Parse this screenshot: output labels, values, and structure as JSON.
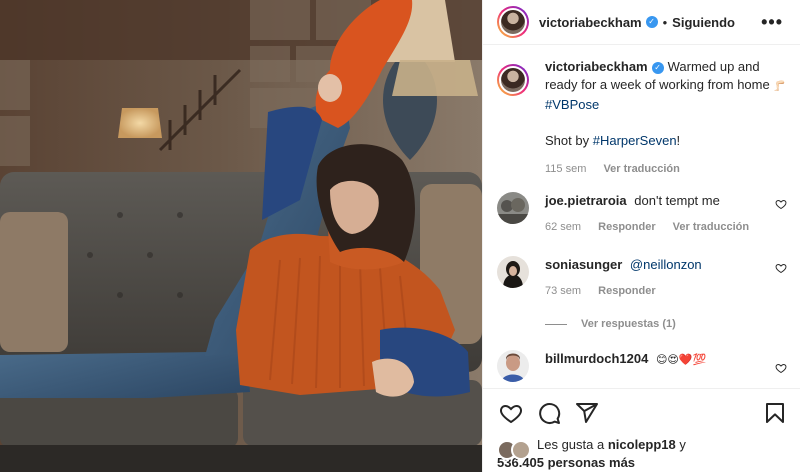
{
  "post": {
    "image_alt": "Photo of a woman in a rust turtleneck stretching one leg up while lying on a grey velvet sofa",
    "icons": {
      "verified": "verified-badge-icon",
      "more": "more-options-icon",
      "like": "heart-icon",
      "comment": "comment-icon",
      "share": "share-icon",
      "save": "bookmark-icon",
      "comment_like": "small-heart-icon"
    },
    "colors": {
      "link": "#00376b",
      "muted": "#8e8e8e",
      "verified": "#3897f0",
      "sweater": "#c2551f"
    }
  },
  "header": {
    "username": "victoriabeckham",
    "verified_glyph": "✓",
    "separator": "•",
    "follow_status": "Siguiendo",
    "more_glyph": "•••"
  },
  "caption": {
    "username": "victoriabeckham",
    "verified_glyph": "✓",
    "text": "Warmed up and ready for a week of working from home",
    "emoji": "🦵🏻",
    "hashtag1": "#VBPose",
    "line2_prefix": "Shot by",
    "hashtag2": "#HarperSeven",
    "line2_suffix": "!",
    "time": "115 sem",
    "translate": "Ver traducción"
  },
  "comments": [
    {
      "username": "joe.pietraroia",
      "text": "don't tempt me",
      "time": "62 sem",
      "reply": "Responder",
      "translate": "Ver traducción"
    },
    {
      "username": "soniasunger",
      "mention": "@neillonzon",
      "time": "73 sem",
      "reply": "Responder"
    },
    {
      "username": "billmurdoch1204",
      "text": "😊😍❤️💯"
    }
  ],
  "replies_toggle": "Ver respuestas (1)",
  "likes": {
    "prefix": "Les gusta a",
    "user": "nicolepp18",
    "conj": "y",
    "count": "536.405 personas más"
  }
}
